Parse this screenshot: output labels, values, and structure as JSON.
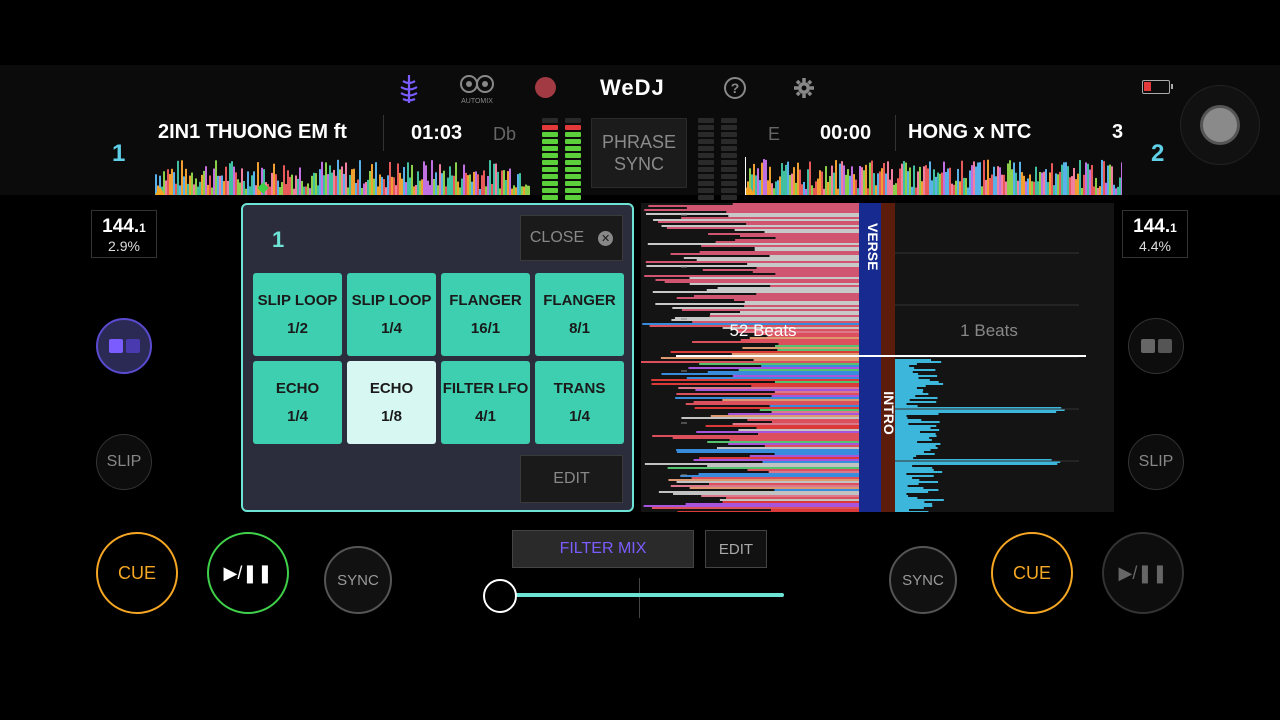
{
  "app": {
    "name": "WeDJ"
  },
  "topbar": {
    "automix_label": "AUTOMIX",
    "icons": [
      "waveform-icon",
      "automix-icon",
      "record-icon",
      "help-icon",
      "settings-icon",
      "battery-icon"
    ]
  },
  "deck1": {
    "number": "1",
    "title": "2IN1 THUONG EM ft",
    "time": "01:03",
    "key": "Db",
    "bpm_main": "144.",
    "bpm_frac": "1",
    "pitch": "2.9%",
    "slip_label": "SLIP",
    "cue_label": "CUE",
    "play_label": "▶/❚❚",
    "sync_label": "SYNC"
  },
  "deck2": {
    "number": "2",
    "title": "HONG x NTC",
    "title_overflow": "3",
    "time": "00:00",
    "key": "E",
    "bpm_main": "144.",
    "bpm_frac": "1",
    "pitch": "4.4%",
    "slip_label": "SLIP",
    "cue_label": "CUE",
    "play_label": "▶/❚❚",
    "sync_label": "SYNC"
  },
  "center": {
    "phrase_sync_line1": "PHRASE",
    "phrase_sync_line2": "SYNC",
    "filter_mix_label": "FILTER MIX",
    "edit_label": "EDIT"
  },
  "fx_panel": {
    "deck": "1",
    "close_label": "CLOSE",
    "edit_label": "EDIT",
    "pads": [
      {
        "name": "SLIP LOOP",
        "value": "1/2",
        "selected": false
      },
      {
        "name": "SLIP LOOP",
        "value": "1/4",
        "selected": false
      },
      {
        "name": "FLANGER",
        "value": "16/1",
        "selected": false
      },
      {
        "name": "FLANGER",
        "value": "8/1",
        "selected": false
      },
      {
        "name": "ECHO",
        "value": "1/4",
        "selected": false
      },
      {
        "name": "ECHO",
        "value": "1/8",
        "selected": true
      },
      {
        "name": "FILTER LFO",
        "value": "4/1",
        "selected": false
      },
      {
        "name": "TRANS",
        "value": "1/4",
        "selected": false
      }
    ]
  },
  "waveform_view": {
    "left_beats": "52 Beats",
    "right_beats": "1 Beats",
    "left_phrase": "VERSE",
    "right_phrase": "INTRO"
  },
  "crossfader": {
    "position": 0.0
  },
  "colors": {
    "accent": "#6ce3d4",
    "cue": "#f5a623",
    "play": "#3fd04a",
    "filter": "#7b5cff",
    "deck_num": "#5fd0e8"
  }
}
